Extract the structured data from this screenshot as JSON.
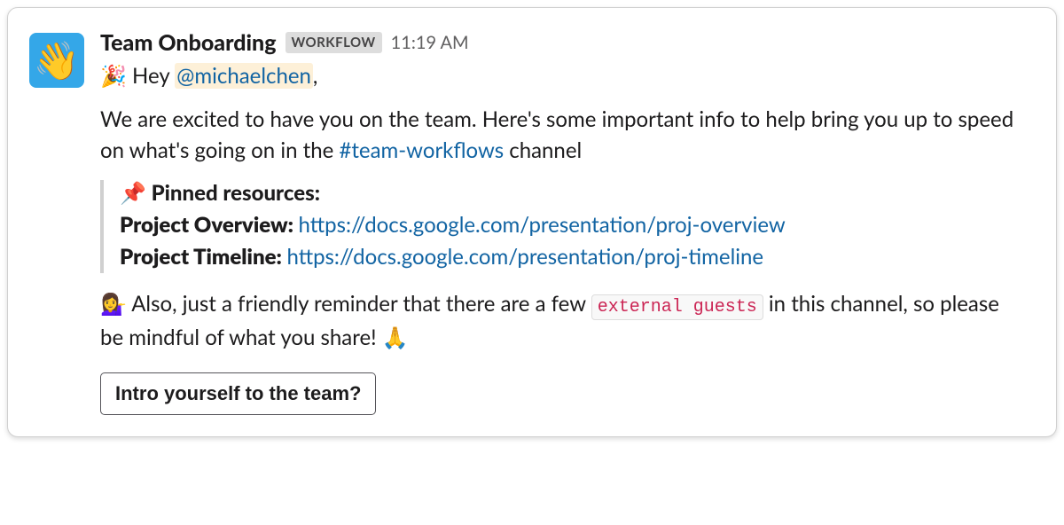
{
  "avatar_emoji": "👋",
  "sender_name": "Team Onboarding",
  "workflow_badge": "WORKFLOW",
  "timestamp": "11:19 AM",
  "greeting": {
    "emoji": "🎉",
    "prefix": "Hey ",
    "mention": "@michaelchen",
    "suffix": ","
  },
  "intro": {
    "line1": "We are excited to have you on the team. Here's some important info to help bring you up to speed on what's going on in the ",
    "channel": "#team-workflows",
    "line1_suffix": " channel"
  },
  "pinned": {
    "emoji": "📌",
    "header": "Pinned resources:",
    "items": [
      {
        "label": "Project Overview: ",
        "url": "https://docs.google.com/presentation/proj-overview"
      },
      {
        "label": "Project Timeline: ",
        "url": "https://docs.google.com/presentation/proj-timeline"
      }
    ]
  },
  "reminder": {
    "emoji_lead": "💁‍♀️",
    "text_before": "Also, just a friendly reminder that there are a few ",
    "code": "external guests",
    "text_after": " in this channel, so please be mindful of what you share! ",
    "emoji_trail": "🙏"
  },
  "action_button": "Intro yourself to the team?"
}
